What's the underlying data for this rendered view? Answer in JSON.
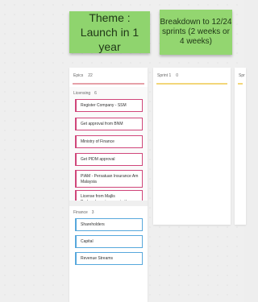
{
  "stickies": {
    "theme": "Theme : Launch in 1 year",
    "breakdown": "Breakdown to 12/24 sprints (2 weeks or 4 weeks)"
  },
  "columns": {
    "epics": {
      "title": "Epics",
      "count": "22"
    },
    "sprint1": {
      "title": "Sprint 1",
      "count": "0"
    },
    "sprint2": {
      "title": "Spr"
    }
  },
  "lanes": {
    "licensing": {
      "title": "Licensing",
      "count": "6",
      "cards": [
        "Register Company - SSM",
        "Get approval from BNM",
        "Ministry of Finance",
        "Get PIDM approval",
        "PIAM - Persatuan Insurance Am Malaysia",
        "License from Majlis Perbandaran to operate the"
      ]
    },
    "finance": {
      "title": "Finance",
      "count": "3",
      "cards": [
        "Shareholders",
        "Capital",
        "Revenue Streams"
      ]
    }
  },
  "colors": {
    "sticky": "#8fd46e",
    "epics_bar": "#e6a1a8",
    "sprint_bar": "#f3d67a",
    "licensing_card": "#d0467a",
    "finance_card": "#57a8dc"
  }
}
